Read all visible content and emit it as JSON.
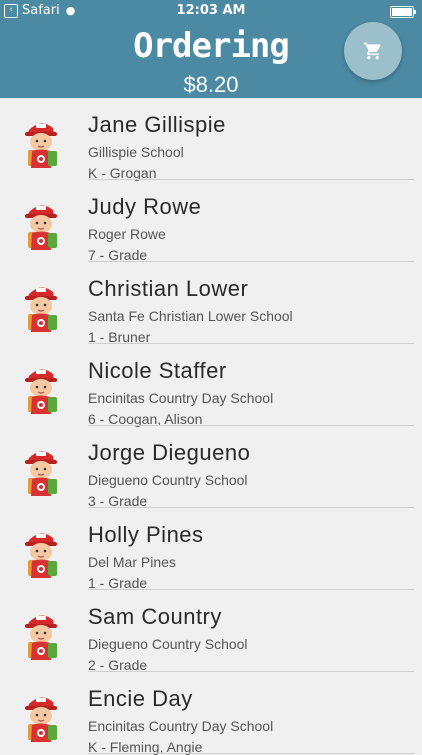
{
  "status": {
    "carrier": "Safari",
    "time": "12:03 AM"
  },
  "header": {
    "title": "Ordering",
    "total": "$8.20"
  },
  "cart": {
    "icon": "cart-icon"
  },
  "students": [
    {
      "name": "Jane Gillispie",
      "school": "Gillispie School",
      "grade": "K - Grogan"
    },
    {
      "name": "Judy Rowe",
      "school": "Roger Rowe",
      "grade": "7 - Grade"
    },
    {
      "name": "Christian Lower",
      "school": "Santa Fe Christian Lower School",
      "grade": "1 - Bruner"
    },
    {
      "name": "Nicole Staffer",
      "school": "Encinitas Country Day School",
      "grade": "6 - Coogan, Alison"
    },
    {
      "name": "Jorge Diegueno",
      "school": "Diegueno Country School",
      "grade": "3 - Grade"
    },
    {
      "name": "Holly Pines",
      "school": "Del Mar Pines",
      "grade": "1 - Grade"
    },
    {
      "name": "Sam Country",
      "school": "Diegueno Country School",
      "grade": "2 - Grade"
    },
    {
      "name": "Encie Day",
      "school": "Encinitas Country Day School",
      "grade": "K - Fleming, Angie"
    }
  ]
}
